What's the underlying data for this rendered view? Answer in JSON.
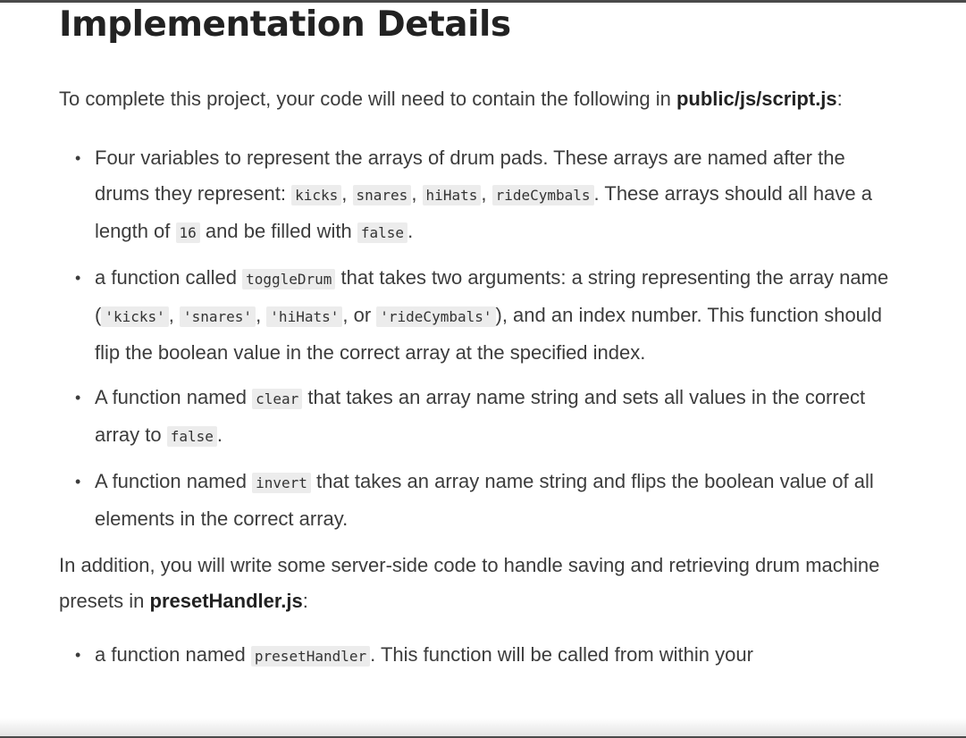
{
  "heading": "Implementation Details",
  "intro": {
    "text": "To complete this project, your code will need to contain the following in ",
    "file": "public/js/script.js",
    "end": ":"
  },
  "items1": [
    {
      "t1": "Four variables to represent the arrays of drum pads. These arrays are named after the drums they represent: ",
      "c1": "kicks",
      "s1": ", ",
      "c2": "snares",
      "s2": ", ",
      "c3": "hiHats",
      "s3": ", ",
      "c4": "rideCymbals",
      "t2": ". These arrays should all have a length of ",
      "c5": "16",
      "t3": " and be filled with ",
      "c6": "false",
      "t4": "."
    },
    {
      "t1": "a function called ",
      "c1": "toggleDrum",
      "t2": " that takes two arguments: a string representing the array name (",
      "c2": "'kicks'",
      "s1": ", ",
      "c3": "'snares'",
      "s2": ", ",
      "c4": "'hiHats'",
      "s3": ", or ",
      "c5": "'rideCymbals'",
      "t3": "), and an index number. This function should flip the boolean value in the correct array at the specified index."
    },
    {
      "t1": "A function named ",
      "c1": "clear",
      "t2": " that takes an array name string and sets all values in the correct array to ",
      "c2": "false",
      "t3": "."
    },
    {
      "t1": "A function named ",
      "c1": "invert",
      "t2": " that takes an array name string and flips the boolean value of all elements in the correct array."
    }
  ],
  "after": {
    "text": "In addition, you will write some server-side code to handle saving and retrieving drum machine presets in ",
    "file": "presetHandler.js",
    "end": ":"
  },
  "items2": [
    {
      "t1": "a function named ",
      "c1": "presetHandler",
      "t2": ". This function will be called from within your"
    }
  ],
  "bullet": "•"
}
